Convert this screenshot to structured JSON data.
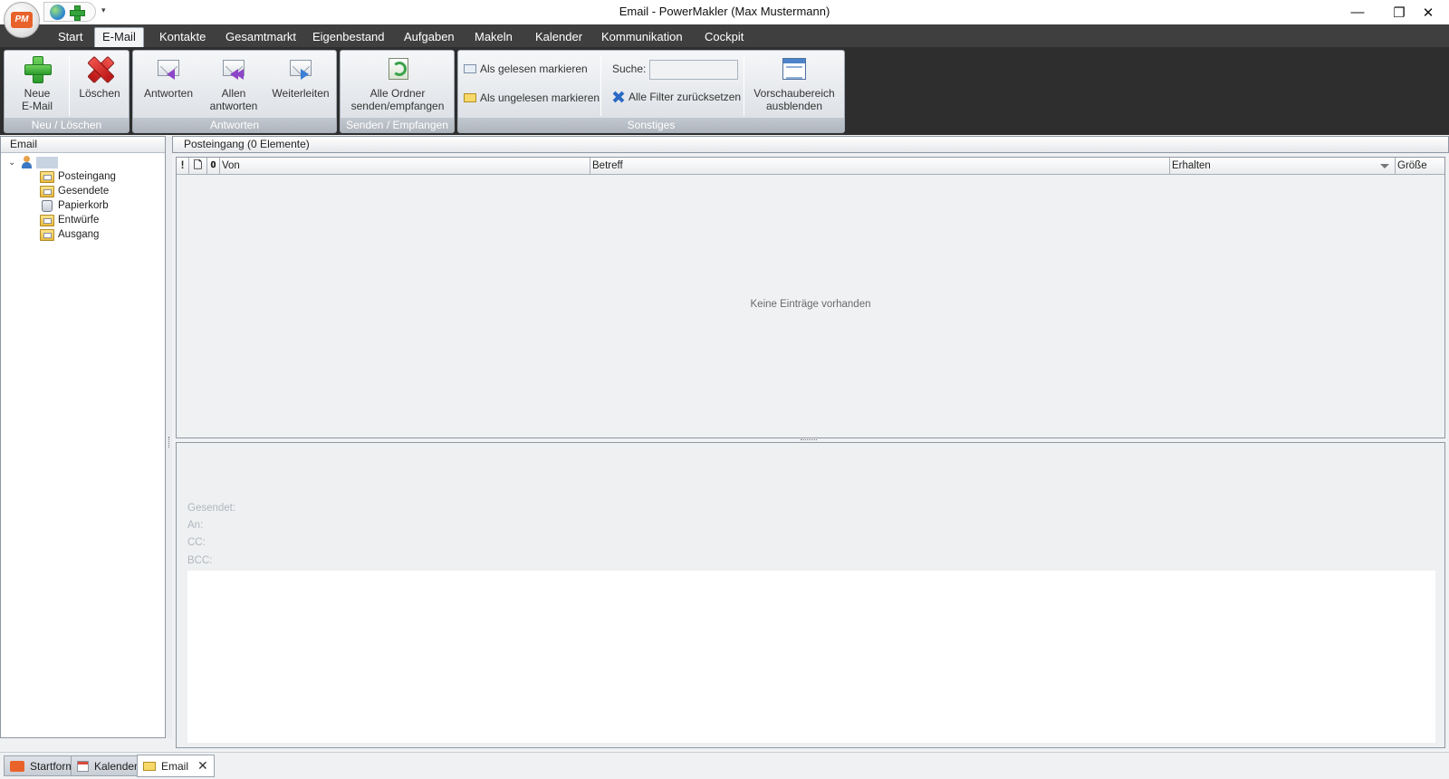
{
  "window": {
    "title": "Email - PowerMakler (Max Mustermann)",
    "minimize": "—",
    "restore": "❐",
    "close": "✕",
    "qat_dropdown": "▾"
  },
  "tabs": [
    "Start",
    "E-Mail",
    "Kontakte",
    "Gesamtmarkt",
    "Eigenbestand",
    "Aufgaben",
    "Makeln",
    "Kalender",
    "Kommunikation",
    "Cockpit"
  ],
  "ribbon": {
    "groups": {
      "neu": "Neu / Löschen",
      "antworten": "Antworten",
      "senden": "Senden / Empfangen",
      "sonstiges": "Sonstiges"
    },
    "buttons": {
      "neue_email_1": "Neue",
      "neue_email_2": "E-Mail",
      "loeschen": "Löschen",
      "antworten": "Antworten",
      "allen_1": "Allen",
      "allen_2": "antworten",
      "weiterleiten": "Weiterleiten",
      "alle_ordner_1": "Alle Ordner",
      "alle_ordner_2": "senden/empfangen",
      "gelesen": "Als gelesen markieren",
      "ungelesen": "Als ungelesen markieren",
      "suche_label": "Suche:",
      "suche_value": "",
      "filter_reset": "Alle Filter zurücksetzen",
      "vorschau_1": "Vorschaubereich",
      "vorschau_2": "ausblenden"
    }
  },
  "folders": {
    "header": "Email",
    "root_label": "",
    "items": [
      "Posteingang",
      "Gesendete",
      "Papierkorb",
      "Entwürfe",
      "Ausgang"
    ]
  },
  "inbox": {
    "header": "Posteingang (0 Elemente)",
    "columns": {
      "importance": "!",
      "type": "🗋",
      "attachment": "𝟎",
      "from": "Von",
      "subject": "Betreff",
      "received": "Erhalten",
      "size": "Größe"
    },
    "empty": "Keine Einträge vorhanden"
  },
  "preview": {
    "sent": "Gesendet:",
    "to": "An:",
    "cc": "CC:",
    "bcc": "BCC:"
  },
  "bottom_tabs": [
    "Startform",
    "Kalender",
    "Email"
  ],
  "colors": {
    "tab_strip": "#3f3f3f",
    "ribbon_bg": "#2e2e2e",
    "brand_orange": "#e8622a"
  }
}
